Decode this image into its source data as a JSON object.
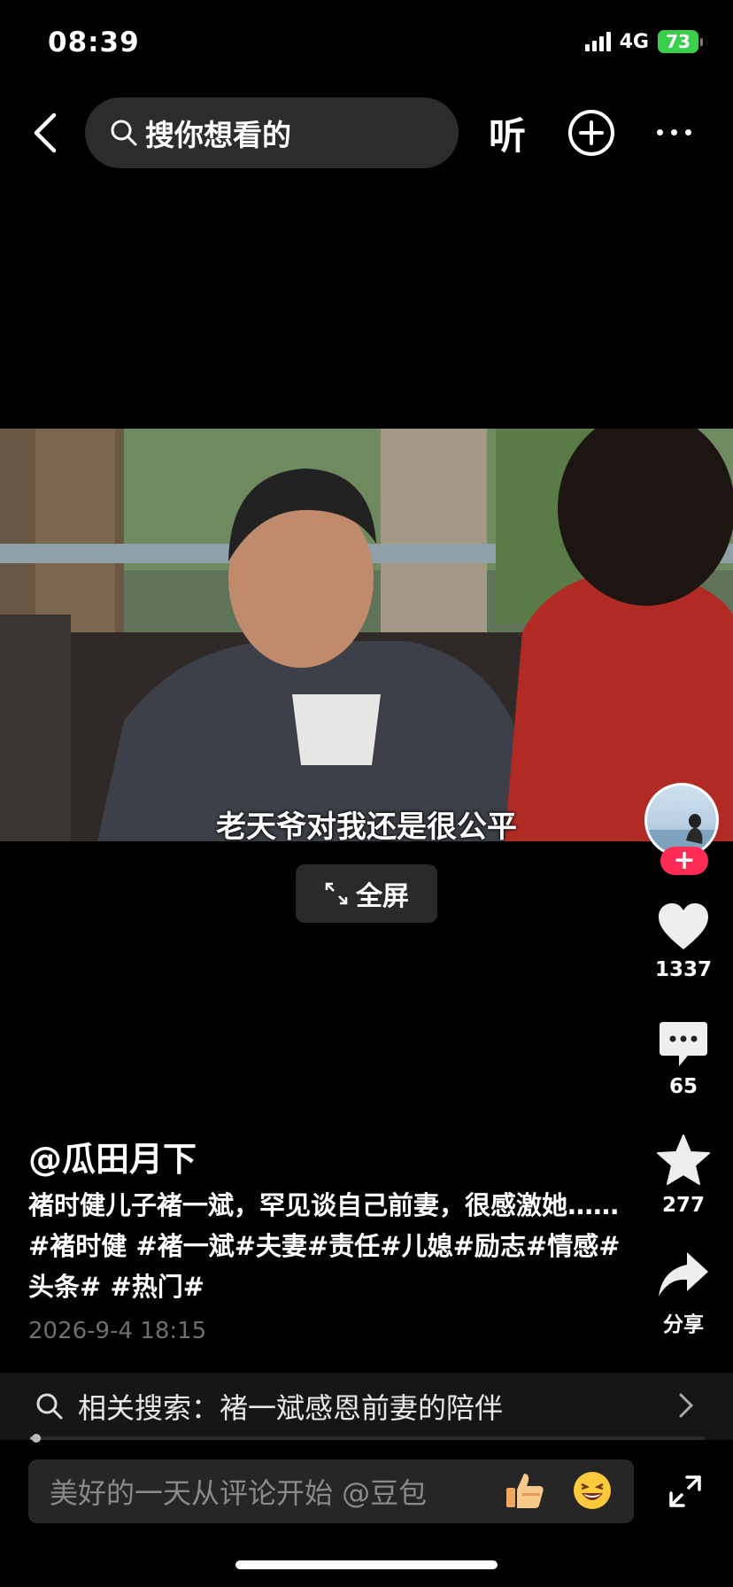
{
  "status_bar": {
    "time": "08:39",
    "network": "4G",
    "battery": "73"
  },
  "header": {
    "search_placeholder": "搜你想看的",
    "listen_label": "听"
  },
  "video": {
    "subtitle": "老天爷对我还是很公平",
    "fullscreen_label": "全屏"
  },
  "actions": {
    "like_count": "1337",
    "comment_count": "65",
    "favorite_count": "277",
    "share_label": "分享"
  },
  "post": {
    "author": "@瓜田月下",
    "description": "褚时健儿子褚一斌，罕见谈自己前妻，很感激她……#褚时健 #褚一斌#夫妻#责任#儿媳#励志#情感#头条# #热门#",
    "date": "2026-9-4 18:15"
  },
  "related_search": {
    "text": "相关搜索：褚一斌感恩前妻的陪伴"
  },
  "playback": {
    "progress_percent": 1
  },
  "comment_bar": {
    "placeholder": "美好的一天从评论开始 @豆包"
  },
  "colors": {
    "accent": "#fe2c55",
    "battery": "#3ccf4e",
    "background": "#000000"
  }
}
